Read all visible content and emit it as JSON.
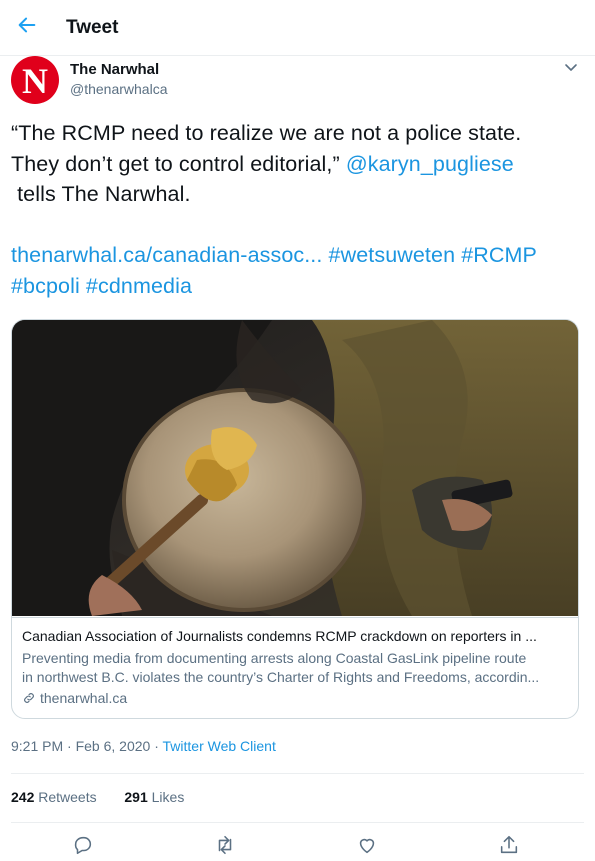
{
  "header": {
    "title": "Tweet"
  },
  "author": {
    "name": "The Narwhal",
    "handle": "@thenarwhalca",
    "avatar_letter": "N",
    "avatar_color": "#e0001b"
  },
  "tweet": {
    "quote_line1": "“The RCMP need to realize we are not a police state.",
    "quote_line2": "They don’t get to control editorial,”",
    "mention": "@karyn_pugliese",
    "tail": "tells The Narwhal.",
    "link": "thenarwhal.ca/canadian-assoc...",
    "hashtags": [
      "#wetsuweten",
      "#RCMP",
      "#bcpoli",
      "#cdnmedia"
    ]
  },
  "card": {
    "title": "Canadian Association of Journalists condemns RCMP crackdown on reporters in ...",
    "description_line1": "Preventing media from documenting arrests along Coastal GasLink pipeline route",
    "description_line2": "in northwest B.C. violates the country’s Charter of Rights and Freedoms, accordin...",
    "domain": "thenarwhal.ca"
  },
  "meta": {
    "time": "9:21 PM · Feb 6, 2020 · ",
    "client": "Twitter Web Client"
  },
  "stats": {
    "retweets": "242",
    "retweets_label": "Retweets",
    "likes": "291",
    "likes_label": "Likes"
  },
  "colors": {
    "link": "#1b95e0",
    "secondary": "#5b7083",
    "border": "#cfd9de"
  },
  "icons": [
    "back-arrow-icon",
    "chevron-down-icon",
    "link-icon",
    "reply-icon",
    "retweet-icon",
    "like-icon",
    "share-icon"
  ]
}
